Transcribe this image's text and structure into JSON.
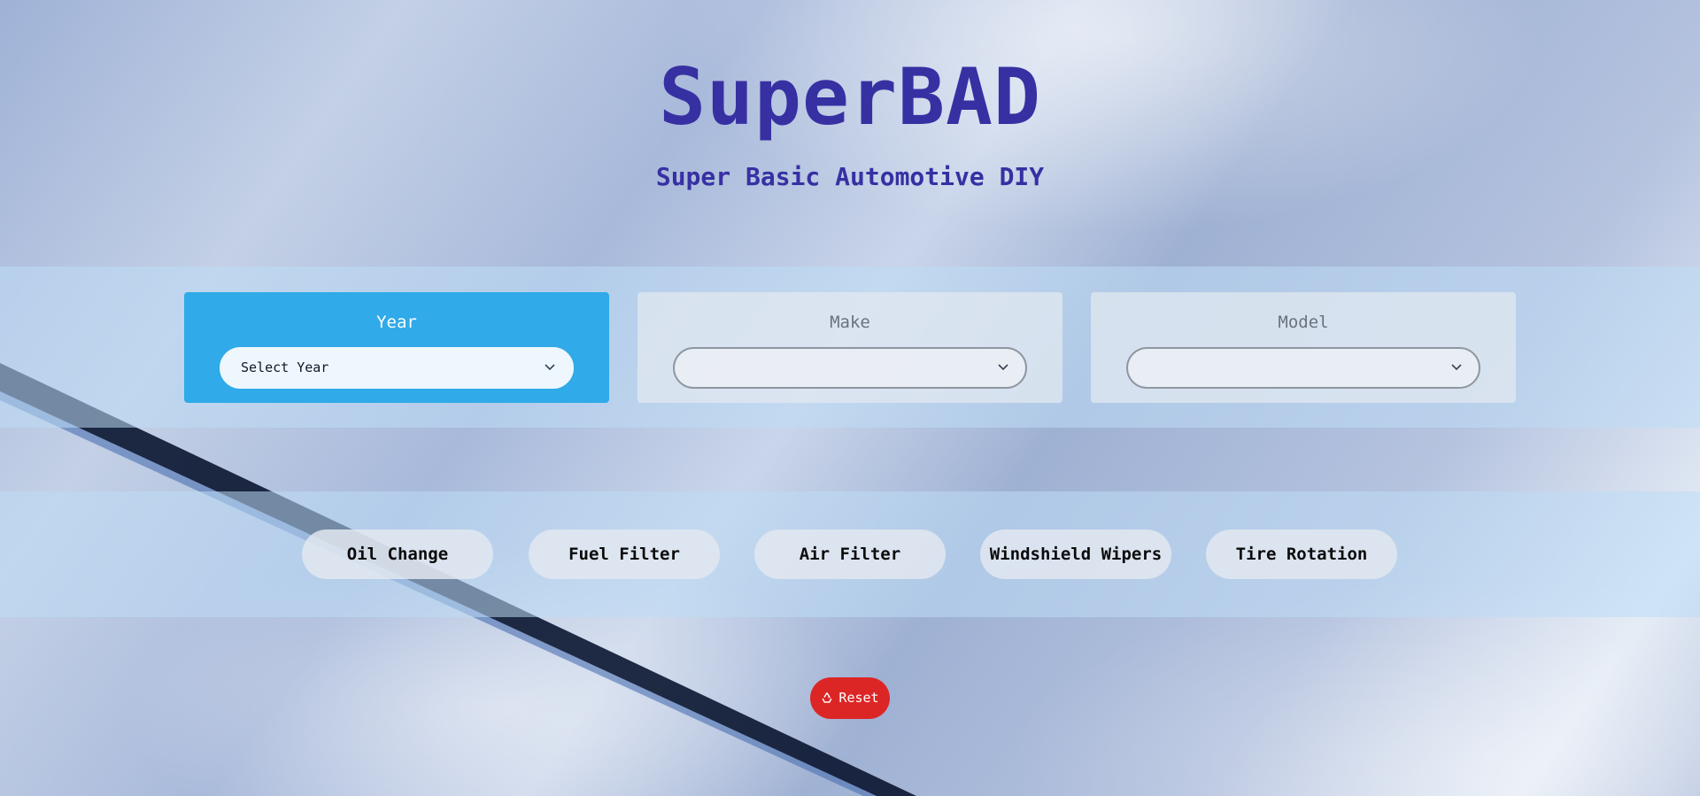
{
  "header": {
    "title": "SuperBAD",
    "subtitle": "Super Basic Automotive DIY"
  },
  "selectors": {
    "year": {
      "label": "Year",
      "value": "Select Year"
    },
    "make": {
      "label": "Make",
      "value": ""
    },
    "model": {
      "label": "Model",
      "value": ""
    }
  },
  "services": [
    {
      "label": "Oil Change"
    },
    {
      "label": "Fuel Filter"
    },
    {
      "label": "Air Filter"
    },
    {
      "label": "Windshield Wipers"
    },
    {
      "label": "Tire Rotation"
    }
  ],
  "reset": {
    "label": "Reset",
    "icon": "recycle-icon"
  },
  "colors": {
    "title": "#3730a3",
    "active_card": "#30aae8",
    "reset": "#dc2626"
  },
  "icons": {
    "dropdown": "chevron-down-icon",
    "reset": "recycle-icon"
  }
}
